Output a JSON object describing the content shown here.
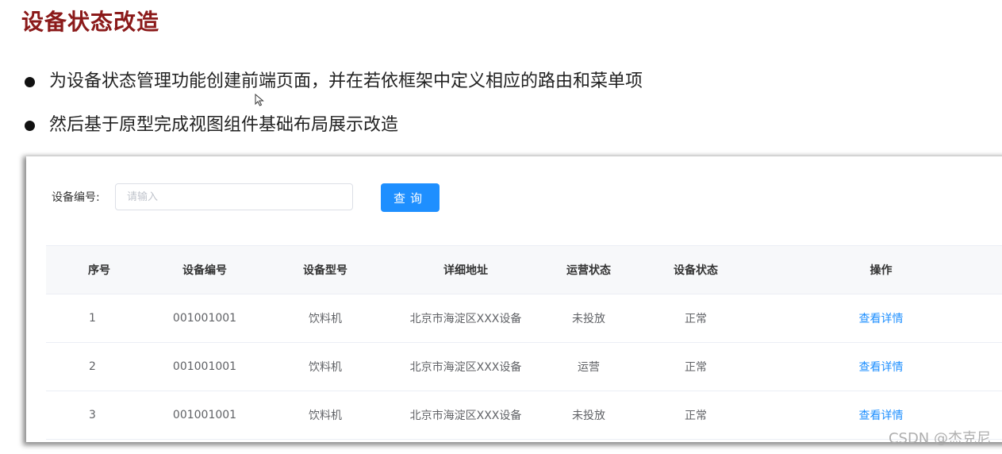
{
  "slide": {
    "title": "设备状态改造",
    "bullets": [
      "为设备状态管理功能创建前端页面，并在若依框架中定义相应的路由和菜单项",
      "然后基于原型完成视图组件基础布局展示改造"
    ]
  },
  "search": {
    "label": "设备编号:",
    "placeholder": "请输入",
    "value": "",
    "button_label": "查询"
  },
  "table": {
    "headers": [
      "序号",
      "设备编号",
      "设备型号",
      "详细地址",
      "运营状态",
      "设备状态",
      "操作"
    ],
    "rows": [
      [
        "1",
        "001001001",
        "饮料机",
        "北京市海淀区XXX设备",
        "未投放",
        "正常",
        "查看详情"
      ],
      [
        "2",
        "001001001",
        "饮料机",
        "北京市海淀区XXX设备",
        "运营",
        "正常",
        "查看详情"
      ],
      [
        "3",
        "001001001",
        "饮料机",
        "北京市海淀区XXX设备",
        "未投放",
        "正常",
        "查看详情"
      ]
    ]
  },
  "watermark": "CSDN @杰克尼",
  "colors": {
    "title": "#8b1a1a",
    "primary": "#1e8fff",
    "header_bg": "#f7f8fa"
  },
  "icons": {
    "cursor": "mouse-pointer-icon",
    "bullet": "bullet-dot-icon"
  }
}
